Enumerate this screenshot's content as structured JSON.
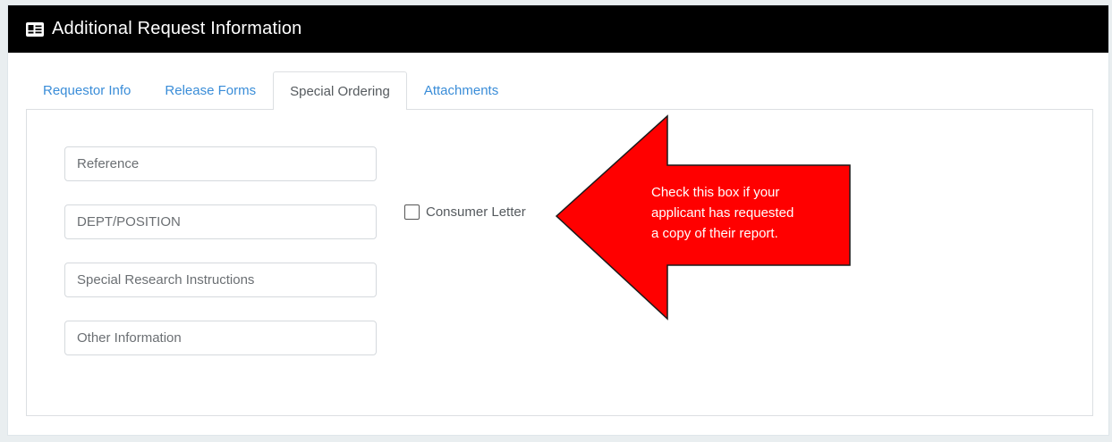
{
  "header": {
    "title": "Additional Request Information",
    "icon": "id-card-icon"
  },
  "tabs": [
    {
      "label": "Requestor Info",
      "active": false
    },
    {
      "label": "Release Forms",
      "active": false
    },
    {
      "label": "Special Ordering",
      "active": true
    },
    {
      "label": "Attachments",
      "active": false
    }
  ],
  "form": {
    "reference": {
      "placeholder": "Reference",
      "value": ""
    },
    "dept_position": {
      "placeholder": "DEPT/POSITION",
      "value": ""
    },
    "special_research": {
      "placeholder": "Special Research Instructions",
      "value": ""
    },
    "other_information": {
      "placeholder": "Other Information",
      "value": ""
    },
    "consumer_letter": {
      "label": "Consumer Letter",
      "checked": false
    }
  },
  "callout": {
    "lines": [
      "Check this box if your",
      "applicant has requested",
      "a copy of their report."
    ],
    "color": "#ff0000"
  },
  "colors": {
    "header_bg": "#000000",
    "tab_link": "#3a8dd8",
    "page_bg": "#e9eef0"
  }
}
